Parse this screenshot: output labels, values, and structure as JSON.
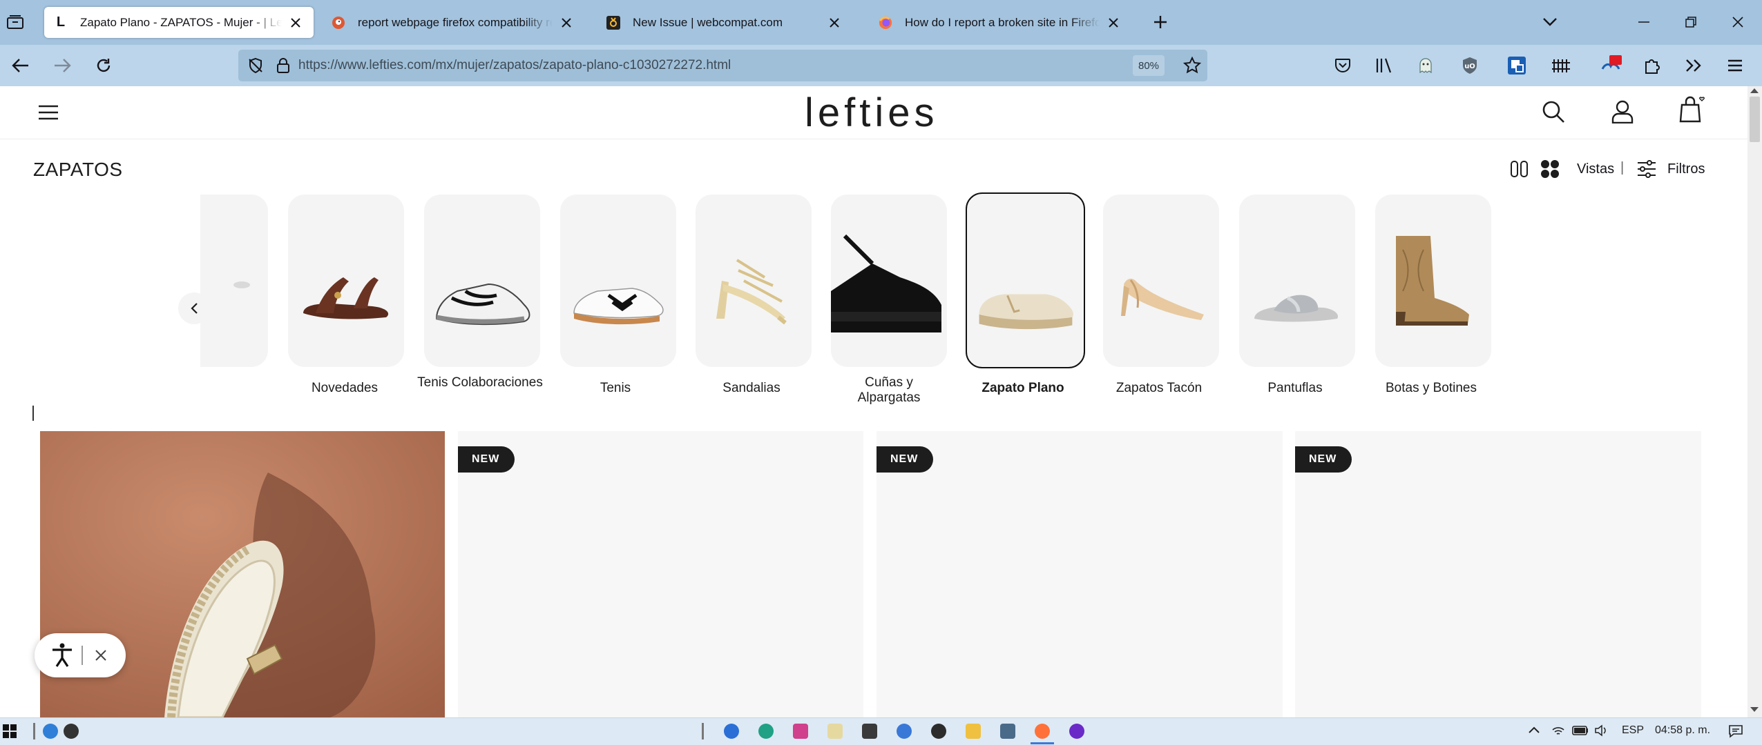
{
  "browser": {
    "tabs": [
      {
        "title": "Zapato Plano - ZAPATOS - Mujer - | Lefties",
        "favicon": "L",
        "active": true
      },
      {
        "title": "report webpage firefox compatibility reddit",
        "favicon": "duckduckgo-icon",
        "active": false
      },
      {
        "title": "New Issue | webcompat.com",
        "favicon": "webcompat-icon",
        "active": false
      },
      {
        "title": "How do I report a broken site in Firefox d",
        "favicon": "firefox-icon",
        "active": false
      }
    ],
    "url": "https://www.lefties.com/mx/mujer/zapatos/zapato-plano-c1030272272.html",
    "zoom": "80%"
  },
  "site": {
    "logo": "lefties",
    "page_title": "ZAPATOS",
    "view_label": "Vistas",
    "separator": "|",
    "filters_label": "Filtros",
    "categories": [
      {
        "label": "Novedades",
        "selected": false
      },
      {
        "label": "Tenis Colaboraciones",
        "selected": false
      },
      {
        "label": "Tenis",
        "selected": false
      },
      {
        "label": "Sandalias",
        "selected": false
      },
      {
        "label": "Cuñas y Alpargatas",
        "selected": false
      },
      {
        "label": "Zapato Plano",
        "selected": true
      },
      {
        "label": "Zapatos Tacón",
        "selected": false
      },
      {
        "label": "Pantuflas",
        "selected": false
      },
      {
        "label": "Botas y Botines",
        "selected": false
      }
    ],
    "badges": [
      "NEW",
      "NEW",
      "NEW"
    ]
  },
  "taskbar": {
    "language": "ESP",
    "time": "04:58 p. m."
  },
  "colors": {
    "tabstrip": "#a3c3de",
    "toolbar": "#bcd5ea",
    "badge": "#1d1d1d"
  }
}
